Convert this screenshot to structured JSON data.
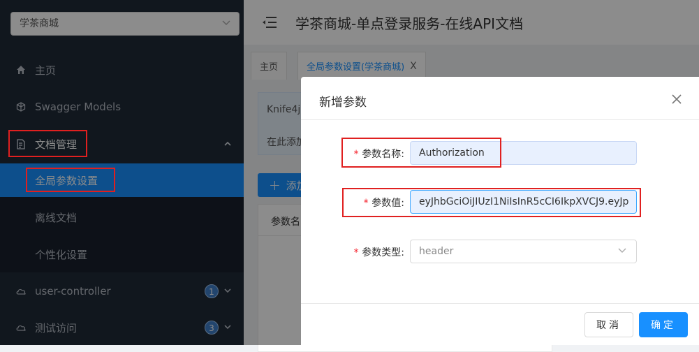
{
  "sidebar": {
    "group_select": "学茶商城",
    "menu": [
      {
        "label": "主页",
        "icon": "home-icon"
      },
      {
        "label": "Swagger Models",
        "icon": "models-icon"
      },
      {
        "label": "文档管理",
        "icon": "document-icon"
      }
    ],
    "submenu": [
      {
        "label": "全局参数设置"
      },
      {
        "label": "离线文档"
      },
      {
        "label": "个性化设置"
      }
    ],
    "groups": [
      {
        "label": "user-controller",
        "badge": "1",
        "icon": "cloud-icon"
      },
      {
        "label": "测试访问",
        "badge": "3",
        "icon": "cloud-icon"
      }
    ]
  },
  "header": {
    "title": "学茶商城-单点登录服务-在线API文档"
  },
  "tabs": [
    {
      "label": "主页"
    },
    {
      "label": "全局参数设置(学茶商城)",
      "close": "X"
    }
  ],
  "content": {
    "info_line1": "Knife4j",
    "info_line2": "在此添加",
    "add_button": "添加",
    "table_header": "参数名"
  },
  "modal": {
    "title": "新增参数",
    "fields": [
      {
        "label": "参数名称:",
        "value": "Authorization"
      },
      {
        "label": "参数值:",
        "value": "eyJhbGciOiJIUzI1NiIsInR5cCI6IkpXVCJ9.eyJp"
      },
      {
        "label": "参数类型:",
        "value": "header"
      }
    ],
    "required_mark": "*",
    "cancel_label": "取消",
    "ok_label": "确定"
  },
  "colors": {
    "primary": "#1890ff",
    "sidebar_bg": "#1f2a38",
    "highlight_box": "#e02020"
  }
}
